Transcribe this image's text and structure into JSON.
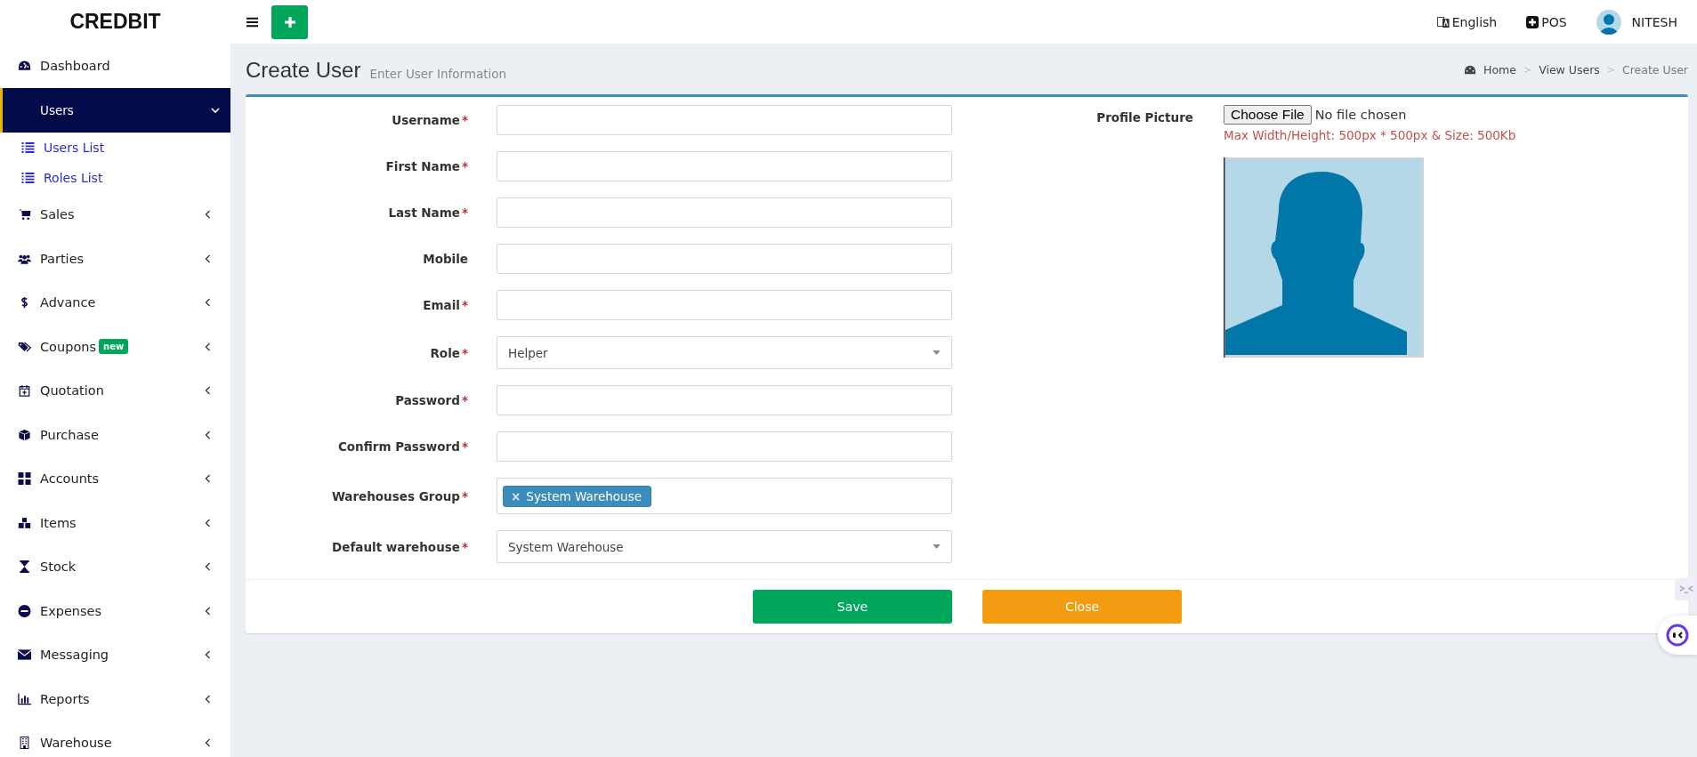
{
  "brand": "CREDBIT",
  "topbar": {
    "language": "English",
    "pos": "POS",
    "user": "NITESH"
  },
  "sidebar": {
    "items": [
      {
        "label": "Dashboard",
        "selected": false
      },
      {
        "label": "Users",
        "selected": true,
        "expanded": true,
        "children": [
          {
            "label": "Users List"
          },
          {
            "label": "Roles List"
          }
        ]
      },
      {
        "label": "Sales",
        "selected": false,
        "expanded": false
      },
      {
        "label": "Parties",
        "selected": false,
        "expanded": false
      },
      {
        "label": "Advance",
        "selected": false,
        "expanded": false
      },
      {
        "label": "Coupons",
        "selected": false,
        "expanded": false,
        "badge": "new"
      },
      {
        "label": "Quotation",
        "selected": false,
        "expanded": false
      },
      {
        "label": "Purchase",
        "selected": false,
        "expanded": false
      },
      {
        "label": "Accounts",
        "selected": false,
        "expanded": false
      },
      {
        "label": "Items",
        "selected": false,
        "expanded": false
      },
      {
        "label": "Stock",
        "selected": false,
        "expanded": false
      },
      {
        "label": "Expenses",
        "selected": false,
        "expanded": false
      },
      {
        "label": "Messaging",
        "selected": false,
        "expanded": false
      },
      {
        "label": "Reports",
        "selected": false,
        "expanded": false
      },
      {
        "label": "Warehouse",
        "selected": false,
        "expanded": false
      }
    ]
  },
  "page": {
    "title": "Create User",
    "subtitle": "Enter User Information",
    "breadcrumb": [
      "Home",
      "View Users",
      "Create User"
    ],
    "breadcrumb_separator": ">"
  },
  "form": {
    "fields": [
      {
        "kind": "text",
        "label": "Username",
        "mark": "*"
      },
      {
        "kind": "text",
        "label": "First Name",
        "mark": "*"
      },
      {
        "kind": "text",
        "label": "Last Name",
        "mark": "*"
      },
      {
        "kind": "text",
        "label": "Mobile"
      },
      {
        "kind": "text",
        "label": "Email",
        "mark": "*"
      },
      {
        "kind": "select",
        "label": "Role",
        "mark": "*",
        "value": "Helper"
      },
      {
        "kind": "text",
        "label": "Password",
        "mark": "*"
      },
      {
        "kind": "text",
        "label": "Confirm Password",
        "mark": "*"
      },
      {
        "kind": "tags",
        "label": "Warehouses Group",
        "mark": "*",
        "tags": [
          {
            "remove": "×",
            "label": "System Warehouse"
          }
        ]
      },
      {
        "kind": "select",
        "label": "Default warehouse",
        "mark": "*",
        "value": "System Warehouse"
      }
    ],
    "profile": {
      "label": "Profile Picture",
      "button": "Choose File",
      "status": "No file chosen",
      "hint": "Max Width/Height: 500px * 500px & Size: 500Kb"
    },
    "buttons": [
      {
        "kind": "save",
        "label": "Save"
      },
      {
        "kind": "close",
        "label": "Close"
      }
    ]
  }
}
